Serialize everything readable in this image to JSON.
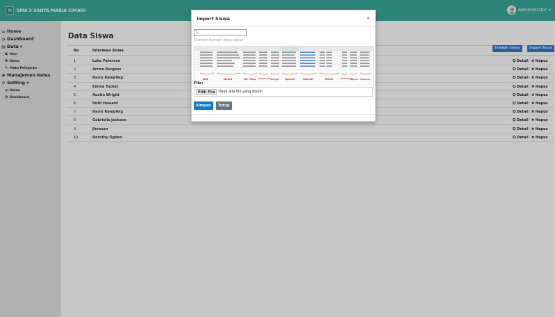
{
  "app": {
    "brand": "SMA 3 SANTA MARIA CIMAHI",
    "user": "Administrator"
  },
  "sidebar": {
    "items": [
      {
        "icon": "home-icon",
        "label": "Home",
        "sub": false
      },
      {
        "icon": "dashboard-icon",
        "label": "Dashboard",
        "sub": false
      },
      {
        "icon": "data-icon",
        "label": "Data ▾",
        "sub": false
      },
      {
        "icon": "user-icon",
        "label": "User",
        "sub": true
      },
      {
        "icon": "class-icon",
        "label": "Kelas",
        "sub": true
      },
      {
        "icon": "pencil-icon",
        "label": "Mata Pelajaran",
        "sub": true
      },
      {
        "icon": "group-icon",
        "label": "Manajemen Kelas",
        "sub": false
      },
      {
        "icon": "gear-icon",
        "label": "Setting ▾",
        "sub": false
      },
      {
        "icon": "home-icon",
        "label": "Home",
        "sub": true
      },
      {
        "icon": "dashboard-icon",
        "label": "Dashboard",
        "sub": true
      }
    ]
  },
  "main": {
    "title": "Data Siswa",
    "col_no": "No",
    "col_info": "Informasi Siswa",
    "btn_add": "Tambah Siswa",
    "btn_import": "Import Excel",
    "detail_label": "Q Detail",
    "hapus_label": "✖ Hapus",
    "rows": [
      {
        "no": "1",
        "name": "Luke Paterson"
      },
      {
        "no": "2",
        "name": "Arrow Burgess"
      },
      {
        "no": "3",
        "name": "Harry Rampling"
      },
      {
        "no": "4",
        "name": "Emma Tucker"
      },
      {
        "no": "5",
        "name": "Austin Wright"
      },
      {
        "no": "6",
        "name": "Ruth Howard"
      },
      {
        "no": "7",
        "name": "Harry Rampling"
      },
      {
        "no": "8",
        "name": "Gabriella Jackson"
      },
      {
        "no": "9",
        "name": "Jhonson"
      },
      {
        "no": "10",
        "name": "Dorothy Ogden"
      }
    ]
  },
  "modal": {
    "title": "Import Siswa",
    "close": "×",
    "input_value": "1",
    "example_label": "Contoh format data excel",
    "file_label": "File:",
    "file_button": "Pilih File",
    "file_text": "Tidak ada file yang dipilih",
    "save": "Simpan",
    "cancel": "Tutup",
    "sheet_headers": [
      "NIS",
      "Nama",
      "No. Telp",
      "Tempat Lahir",
      "Tanggal",
      "Agama",
      "Alamat",
      "Email",
      "Tahun Masuk",
      "Agama",
      "Password"
    ]
  },
  "colors": {
    "topbar": "#3aa99a",
    "primary": "#1478d4",
    "secondary": "#6c757d",
    "sidebar": "#e3e3e3"
  }
}
